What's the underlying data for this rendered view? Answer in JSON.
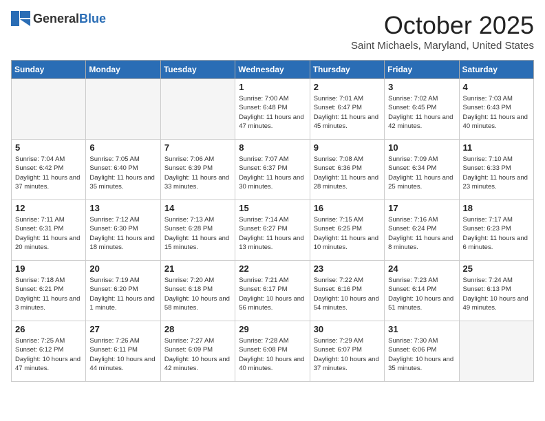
{
  "header": {
    "logo_general": "General",
    "logo_blue": "Blue",
    "month": "October 2025",
    "location": "Saint Michaels, Maryland, United States"
  },
  "days_of_week": [
    "Sunday",
    "Monday",
    "Tuesday",
    "Wednesday",
    "Thursday",
    "Friday",
    "Saturday"
  ],
  "weeks": [
    [
      {
        "day": "",
        "empty": true
      },
      {
        "day": "",
        "empty": true
      },
      {
        "day": "",
        "empty": true
      },
      {
        "day": "1",
        "sunrise": "7:00 AM",
        "sunset": "6:48 PM",
        "daylight": "11 hours and 47 minutes."
      },
      {
        "day": "2",
        "sunrise": "7:01 AM",
        "sunset": "6:47 PM",
        "daylight": "11 hours and 45 minutes."
      },
      {
        "day": "3",
        "sunrise": "7:02 AM",
        "sunset": "6:45 PM",
        "daylight": "11 hours and 42 minutes."
      },
      {
        "day": "4",
        "sunrise": "7:03 AM",
        "sunset": "6:43 PM",
        "daylight": "11 hours and 40 minutes."
      }
    ],
    [
      {
        "day": "5",
        "sunrise": "7:04 AM",
        "sunset": "6:42 PM",
        "daylight": "11 hours and 37 minutes."
      },
      {
        "day": "6",
        "sunrise": "7:05 AM",
        "sunset": "6:40 PM",
        "daylight": "11 hours and 35 minutes."
      },
      {
        "day": "7",
        "sunrise": "7:06 AM",
        "sunset": "6:39 PM",
        "daylight": "11 hours and 33 minutes."
      },
      {
        "day": "8",
        "sunrise": "7:07 AM",
        "sunset": "6:37 PM",
        "daylight": "11 hours and 30 minutes."
      },
      {
        "day": "9",
        "sunrise": "7:08 AM",
        "sunset": "6:36 PM",
        "daylight": "11 hours and 28 minutes."
      },
      {
        "day": "10",
        "sunrise": "7:09 AM",
        "sunset": "6:34 PM",
        "daylight": "11 hours and 25 minutes."
      },
      {
        "day": "11",
        "sunrise": "7:10 AM",
        "sunset": "6:33 PM",
        "daylight": "11 hours and 23 minutes."
      }
    ],
    [
      {
        "day": "12",
        "sunrise": "7:11 AM",
        "sunset": "6:31 PM",
        "daylight": "11 hours and 20 minutes."
      },
      {
        "day": "13",
        "sunrise": "7:12 AM",
        "sunset": "6:30 PM",
        "daylight": "11 hours and 18 minutes."
      },
      {
        "day": "14",
        "sunrise": "7:13 AM",
        "sunset": "6:28 PM",
        "daylight": "11 hours and 15 minutes."
      },
      {
        "day": "15",
        "sunrise": "7:14 AM",
        "sunset": "6:27 PM",
        "daylight": "11 hours and 13 minutes."
      },
      {
        "day": "16",
        "sunrise": "7:15 AM",
        "sunset": "6:25 PM",
        "daylight": "11 hours and 10 minutes."
      },
      {
        "day": "17",
        "sunrise": "7:16 AM",
        "sunset": "6:24 PM",
        "daylight": "11 hours and 8 minutes."
      },
      {
        "day": "18",
        "sunrise": "7:17 AM",
        "sunset": "6:23 PM",
        "daylight": "11 hours and 6 minutes."
      }
    ],
    [
      {
        "day": "19",
        "sunrise": "7:18 AM",
        "sunset": "6:21 PM",
        "daylight": "11 hours and 3 minutes."
      },
      {
        "day": "20",
        "sunrise": "7:19 AM",
        "sunset": "6:20 PM",
        "daylight": "11 hours and 1 minute."
      },
      {
        "day": "21",
        "sunrise": "7:20 AM",
        "sunset": "6:18 PM",
        "daylight": "10 hours and 58 minutes."
      },
      {
        "day": "22",
        "sunrise": "7:21 AM",
        "sunset": "6:17 PM",
        "daylight": "10 hours and 56 minutes."
      },
      {
        "day": "23",
        "sunrise": "7:22 AM",
        "sunset": "6:16 PM",
        "daylight": "10 hours and 54 minutes."
      },
      {
        "day": "24",
        "sunrise": "7:23 AM",
        "sunset": "6:14 PM",
        "daylight": "10 hours and 51 minutes."
      },
      {
        "day": "25",
        "sunrise": "7:24 AM",
        "sunset": "6:13 PM",
        "daylight": "10 hours and 49 minutes."
      }
    ],
    [
      {
        "day": "26",
        "sunrise": "7:25 AM",
        "sunset": "6:12 PM",
        "daylight": "10 hours and 47 minutes."
      },
      {
        "day": "27",
        "sunrise": "7:26 AM",
        "sunset": "6:11 PM",
        "daylight": "10 hours and 44 minutes."
      },
      {
        "day": "28",
        "sunrise": "7:27 AM",
        "sunset": "6:09 PM",
        "daylight": "10 hours and 42 minutes."
      },
      {
        "day": "29",
        "sunrise": "7:28 AM",
        "sunset": "6:08 PM",
        "daylight": "10 hours and 40 minutes."
      },
      {
        "day": "30",
        "sunrise": "7:29 AM",
        "sunset": "6:07 PM",
        "daylight": "10 hours and 37 minutes."
      },
      {
        "day": "31",
        "sunrise": "7:30 AM",
        "sunset": "6:06 PM",
        "daylight": "10 hours and 35 minutes."
      },
      {
        "day": "",
        "empty": true
      }
    ]
  ]
}
